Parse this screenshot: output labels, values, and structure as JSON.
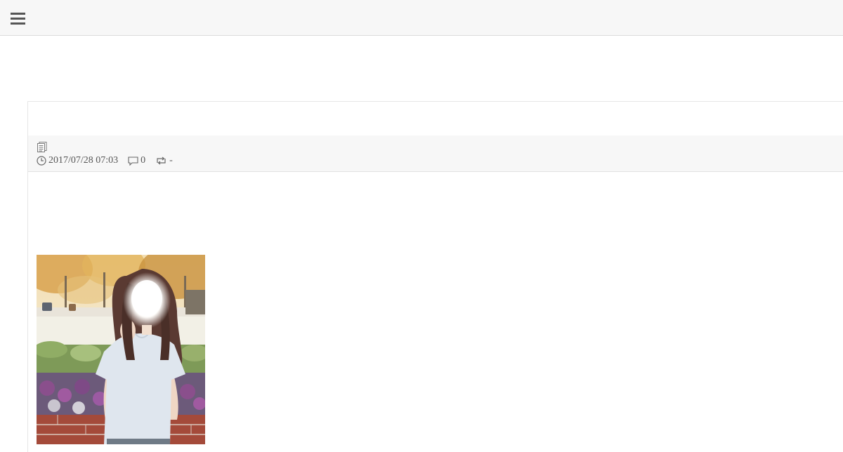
{
  "header": {
    "menu_icon": "hamburger-menu-icon"
  },
  "post": {
    "category_icon": "document-icon",
    "datetime_icon": "clock-icon",
    "datetime": "2017/07/28 07:03",
    "comments_icon": "comment-icon",
    "comments_count": "0",
    "retweet_icon": "repost-icon",
    "retweet_count": "-",
    "photo": {
      "subject": "woman in light blue t-shirt with blurred face, autumn trees and ornamental cabbage flower bed",
      "colors": {
        "sky": "#f1e2c4",
        "foliage": "#d9a65a",
        "shirt": "#dfe6ee",
        "hair": "#5a3a32",
        "flowers": "#8a4f8c"
      }
    }
  }
}
